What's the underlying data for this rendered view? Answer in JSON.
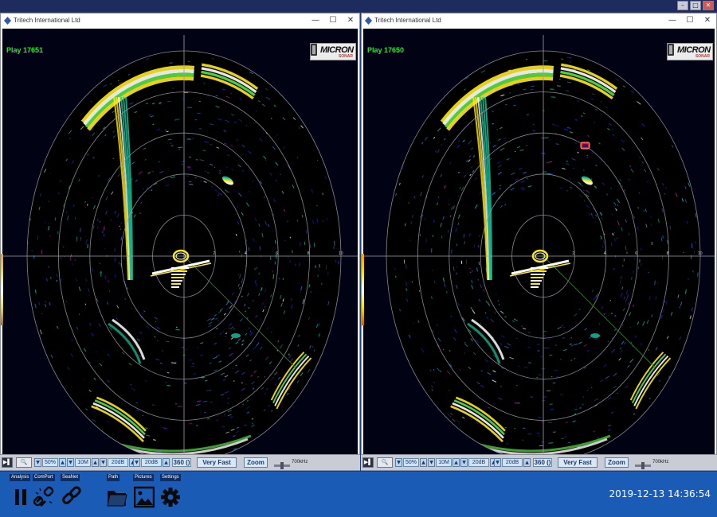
{
  "window_title": "Tritech International Ltd",
  "window_controls": {
    "minimize": "—",
    "maximize": "☐",
    "close": "✕"
  },
  "top_controls": {
    "minimize": "–",
    "restore": "□",
    "close": "✕"
  },
  "panels": [
    {
      "play_label": "Play 17651",
      "logo_text": "MICRON",
      "logo_sub": "SONAR"
    },
    {
      "play_label": "Play 17650",
      "logo_text": "MICRON",
      "logo_sub": "SONAR"
    }
  ],
  "range_labels": [
    "2",
    "4",
    "6",
    "8",
    "10"
  ],
  "controls": {
    "gain": "50%",
    "range": "10M",
    "threshold_low": "20dB",
    "threshold_high": "20dB",
    "sector": "360 ()",
    "speed": "Very Fast",
    "zoom": "Zoom",
    "frequency": "700kHz",
    "up_arrow": "▲",
    "down_arrow": "▼"
  },
  "toolbar": [
    {
      "label": "Analysis",
      "icon": "pause-icon"
    },
    {
      "label": "ComPort",
      "icon": "link-broken-icon"
    },
    {
      "label": "SeaNet",
      "icon": "link-icon"
    },
    {
      "label": "Path",
      "icon": "folder-icon"
    },
    {
      "label": "Pictures",
      "icon": "picture-icon"
    },
    {
      "label": "Settings",
      "icon": "gear-icon"
    }
  ],
  "clock": "2019-12-13  14:36:54",
  "colors": {
    "taskbar": "#1a5bb5",
    "sonar_bg": "#020215",
    "play_label": "#22ee22"
  }
}
